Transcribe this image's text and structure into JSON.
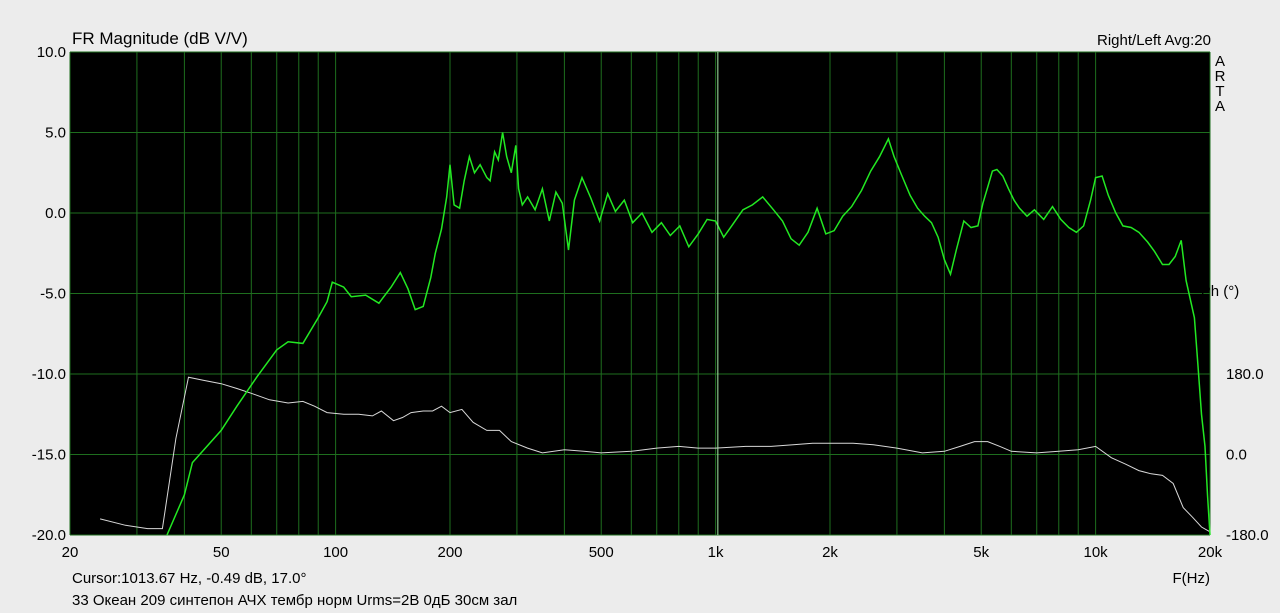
{
  "chart_data": {
    "type": "line",
    "title": "FR Magnitude (dB V/V)",
    "header_right": "Right/Left  Avg:20",
    "brand_letters": [
      "A",
      "R",
      "T",
      "A"
    ],
    "xlabel": "F(Hz)",
    "ylabel_right": "Ph (°)",
    "x_scale": "log",
    "xlim": [
      20,
      20000
    ],
    "ylim": [
      -20,
      10
    ],
    "x_ticks": [
      {
        "value": 20,
        "label": "20"
      },
      {
        "value": 50,
        "label": "50"
      },
      {
        "value": 100,
        "label": "100"
      },
      {
        "value": 200,
        "label": "200"
      },
      {
        "value": 500,
        "label": "500"
      },
      {
        "value": 1000,
        "label": "1k"
      },
      {
        "value": 2000,
        "label": "2k"
      },
      {
        "value": 5000,
        "label": "5k"
      },
      {
        "value": 10000,
        "label": "10k"
      },
      {
        "value": 20000,
        "label": "20k"
      }
    ],
    "y_ticks": [
      {
        "value": 10,
        "label": "10.0"
      },
      {
        "value": 5,
        "label": "5.0"
      },
      {
        "value": 0,
        "label": "0.0"
      },
      {
        "value": -5,
        "label": "-5.0"
      },
      {
        "value": -10,
        "label": "-10.0"
      },
      {
        "value": -15,
        "label": "-15.0"
      },
      {
        "value": -20,
        "label": "-20.0"
      }
    ],
    "phase_ticks": [
      {
        "value": 180,
        "label": "180.0"
      },
      {
        "value": 0,
        "label": "0.0"
      },
      {
        "value": -180,
        "label": "-180.0"
      }
    ],
    "phase_range": [
      -180,
      180
    ],
    "cursor": {
      "x": 1013.67,
      "text": "Cursor:1013.67 Hz, -0.49 dB, 17.0°"
    },
    "caption": "33 Океан 209 синтепон АЧХ тембр норм Urms=2В 0дБ 30см зал",
    "grid": true,
    "colors": {
      "background": "#000000",
      "grid": "#1e6e1e",
      "magnitude": "#22e822",
      "phase": "#d8d8d8",
      "cursor": "#a8e8a8"
    },
    "series": [
      {
        "key": "magnitude",
        "points": [
          [
            36,
            -20
          ],
          [
            40,
            -17.5
          ],
          [
            42,
            -15.5
          ],
          [
            50,
            -13.5
          ],
          [
            55,
            -12
          ],
          [
            62,
            -10.2
          ],
          [
            70,
            -8.5
          ],
          [
            75,
            -8
          ],
          [
            82,
            -8.1
          ],
          [
            90,
            -6.5
          ],
          [
            95,
            -5.5
          ],
          [
            98,
            -4.3
          ],
          [
            105,
            -4.6
          ],
          [
            110,
            -5.2
          ],
          [
            120,
            -5.1
          ],
          [
            130,
            -5.6
          ],
          [
            140,
            -4.6
          ],
          [
            148,
            -3.7
          ],
          [
            155,
            -4.7
          ],
          [
            162,
            -6.0
          ],
          [
            170,
            -5.8
          ],
          [
            178,
            -4
          ],
          [
            183,
            -2.5
          ],
          [
            190,
            -1
          ],
          [
            196,
            1
          ],
          [
            200,
            3
          ],
          [
            205,
            0.5
          ],
          [
            212,
            0.3
          ],
          [
            218,
            2
          ],
          [
            225,
            3.5
          ],
          [
            232,
            2.5
          ],
          [
            240,
            3
          ],
          [
            250,
            2.2
          ],
          [
            255,
            2
          ],
          [
            262,
            3.8
          ],
          [
            268,
            3.3
          ],
          [
            275,
            5
          ],
          [
            282,
            3.5
          ],
          [
            290,
            2.5
          ],
          [
            298,
            4.2
          ],
          [
            303,
            1.5
          ],
          [
            310,
            0.5
          ],
          [
            320,
            1
          ],
          [
            335,
            0.2
          ],
          [
            350,
            1.5
          ],
          [
            365,
            -0.5
          ],
          [
            380,
            1.3
          ],
          [
            395,
            0.6
          ],
          [
            410,
            -2.3
          ],
          [
            425,
            0.8
          ],
          [
            445,
            2.2
          ],
          [
            470,
            0.9
          ],
          [
            495,
            -0.5
          ],
          [
            520,
            1.2
          ],
          [
            545,
            0.1
          ],
          [
            575,
            0.8
          ],
          [
            605,
            -0.6
          ],
          [
            640,
            0
          ],
          [
            680,
            -1.2
          ],
          [
            720,
            -0.6
          ],
          [
            760,
            -1.4
          ],
          [
            805,
            -0.8
          ],
          [
            850,
            -2.1
          ],
          [
            900,
            -1.3
          ],
          [
            950,
            -0.4
          ],
          [
            1000,
            -0.5
          ],
          [
            1050,
            -1.5
          ],
          [
            1110,
            -0.7
          ],
          [
            1180,
            0.2
          ],
          [
            1250,
            0.5
          ],
          [
            1330,
            1
          ],
          [
            1420,
            0.2
          ],
          [
            1500,
            -0.5
          ],
          [
            1580,
            -1.6
          ],
          [
            1660,
            -2.0
          ],
          [
            1750,
            -1.2
          ],
          [
            1850,
            0.3
          ],
          [
            1950,
            -1.3
          ],
          [
            2050,
            -1.1
          ],
          [
            2160,
            -0.2
          ],
          [
            2280,
            0.4
          ],
          [
            2420,
            1.4
          ],
          [
            2560,
            2.6
          ],
          [
            2700,
            3.5
          ],
          [
            2850,
            4.6
          ],
          [
            2950,
            3.5
          ],
          [
            3080,
            2.4
          ],
          [
            3250,
            1.1
          ],
          [
            3400,
            0.3
          ],
          [
            3550,
            -0.2
          ],
          [
            3700,
            -0.6
          ],
          [
            3850,
            -1.5
          ],
          [
            4000,
            -2.9
          ],
          [
            4150,
            -3.8
          ],
          [
            4300,
            -2.3
          ],
          [
            4500,
            -0.5
          ],
          [
            4700,
            -0.9
          ],
          [
            4900,
            -0.8
          ],
          [
            5050,
            0.6
          ],
          [
            5200,
            1.6
          ],
          [
            5350,
            2.6
          ],
          [
            5500,
            2.7
          ],
          [
            5700,
            2.3
          ],
          [
            5900,
            1.5
          ],
          [
            6100,
            0.8
          ],
          [
            6300,
            0.3
          ],
          [
            6600,
            -0.2
          ],
          [
            6900,
            0.2
          ],
          [
            7300,
            -0.4
          ],
          [
            7700,
            0.4
          ],
          [
            8100,
            -0.4
          ],
          [
            8500,
            -0.9
          ],
          [
            8900,
            -1.2
          ],
          [
            9300,
            -0.8
          ],
          [
            9700,
            0.8
          ],
          [
            10000,
            2.2
          ],
          [
            10400,
            2.3
          ],
          [
            10800,
            1.1
          ],
          [
            11300,
            0
          ],
          [
            11800,
            -0.8
          ],
          [
            12400,
            -0.9
          ],
          [
            13000,
            -1.2
          ],
          [
            13700,
            -1.8
          ],
          [
            14300,
            -2.4
          ],
          [
            15000,
            -3.2
          ],
          [
            15600,
            -3.2
          ],
          [
            16200,
            -2.7
          ],
          [
            16800,
            -1.7
          ],
          [
            17300,
            -4.2
          ],
          [
            17800,
            -5.5
          ],
          [
            18200,
            -6.5
          ],
          [
            18600,
            -9.5
          ],
          [
            19000,
            -12.5
          ],
          [
            19400,
            -14.5
          ],
          [
            19700,
            -17.5
          ],
          [
            20000,
            -20
          ]
        ]
      },
      {
        "key": "phase",
        "points": [
          [
            24,
            -19
          ],
          [
            28,
            -19.4
          ],
          [
            32,
            -19.6
          ],
          [
            35,
            -19.6
          ],
          [
            38,
            -14
          ],
          [
            41,
            -10.2
          ],
          [
            45,
            -10.4
          ],
          [
            50,
            -10.6
          ],
          [
            55,
            -10.9
          ],
          [
            60,
            -11.2
          ],
          [
            67,
            -11.6
          ],
          [
            75,
            -11.8
          ],
          [
            82,
            -11.7
          ],
          [
            88,
            -12
          ],
          [
            95,
            -12.4
          ],
          [
            105,
            -12.5
          ],
          [
            115,
            -12.5
          ],
          [
            125,
            -12.6
          ],
          [
            132,
            -12.3
          ],
          [
            142,
            -12.9
          ],
          [
            150,
            -12.7
          ],
          [
            158,
            -12.4
          ],
          [
            170,
            -12.3
          ],
          [
            180,
            -12.3
          ],
          [
            190,
            -12.0
          ],
          [
            200,
            -12.4
          ],
          [
            215,
            -12.2
          ],
          [
            230,
            -13
          ],
          [
            250,
            -13.5
          ],
          [
            270,
            -13.5
          ],
          [
            290,
            -14.2
          ],
          [
            320,
            -14.6
          ],
          [
            350,
            -14.9
          ],
          [
            400,
            -14.7
          ],
          [
            450,
            -14.8
          ],
          [
            500,
            -14.9
          ],
          [
            600,
            -14.8
          ],
          [
            700,
            -14.6
          ],
          [
            800,
            -14.5
          ],
          [
            900,
            -14.6
          ],
          [
            1000,
            -14.6
          ],
          [
            1200,
            -14.5
          ],
          [
            1400,
            -14.5
          ],
          [
            1600,
            -14.4
          ],
          [
            1800,
            -14.3
          ],
          [
            2000,
            -14.3
          ],
          [
            2300,
            -14.3
          ],
          [
            2600,
            -14.4
          ],
          [
            3000,
            -14.6
          ],
          [
            3500,
            -14.9
          ],
          [
            4000,
            -14.8
          ],
          [
            4400,
            -14.5
          ],
          [
            4800,
            -14.2
          ],
          [
            5200,
            -14.2
          ],
          [
            5600,
            -14.5
          ],
          [
            6000,
            -14.8
          ],
          [
            7000,
            -14.9
          ],
          [
            8000,
            -14.8
          ],
          [
            9000,
            -14.7
          ],
          [
            10000,
            -14.5
          ],
          [
            11000,
            -15.2
          ],
          [
            12000,
            -15.6
          ],
          [
            13000,
            -16.0
          ],
          [
            14000,
            -16.2
          ],
          [
            15000,
            -16.3
          ],
          [
            16000,
            -16.8
          ],
          [
            17000,
            -18.3
          ],
          [
            18000,
            -18.9
          ],
          [
            19000,
            -19.5
          ],
          [
            20000,
            -19.8
          ]
        ]
      }
    ]
  }
}
